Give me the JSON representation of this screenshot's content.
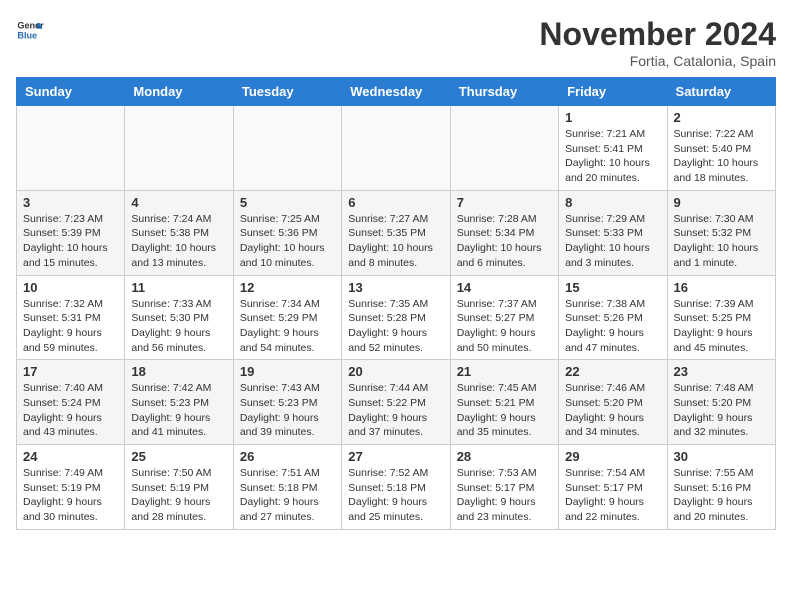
{
  "header": {
    "logo_line1": "General",
    "logo_line2": "Blue",
    "month": "November 2024",
    "location": "Fortia, Catalonia, Spain"
  },
  "weekdays": [
    "Sunday",
    "Monday",
    "Tuesday",
    "Wednesday",
    "Thursday",
    "Friday",
    "Saturday"
  ],
  "weeks": [
    [
      {
        "day": "",
        "info": ""
      },
      {
        "day": "",
        "info": ""
      },
      {
        "day": "",
        "info": ""
      },
      {
        "day": "",
        "info": ""
      },
      {
        "day": "",
        "info": ""
      },
      {
        "day": "1",
        "info": "Sunrise: 7:21 AM\nSunset: 5:41 PM\nDaylight: 10 hours and 20 minutes."
      },
      {
        "day": "2",
        "info": "Sunrise: 7:22 AM\nSunset: 5:40 PM\nDaylight: 10 hours and 18 minutes."
      }
    ],
    [
      {
        "day": "3",
        "info": "Sunrise: 7:23 AM\nSunset: 5:39 PM\nDaylight: 10 hours and 15 minutes."
      },
      {
        "day": "4",
        "info": "Sunrise: 7:24 AM\nSunset: 5:38 PM\nDaylight: 10 hours and 13 minutes."
      },
      {
        "day": "5",
        "info": "Sunrise: 7:25 AM\nSunset: 5:36 PM\nDaylight: 10 hours and 10 minutes."
      },
      {
        "day": "6",
        "info": "Sunrise: 7:27 AM\nSunset: 5:35 PM\nDaylight: 10 hours and 8 minutes."
      },
      {
        "day": "7",
        "info": "Sunrise: 7:28 AM\nSunset: 5:34 PM\nDaylight: 10 hours and 6 minutes."
      },
      {
        "day": "8",
        "info": "Sunrise: 7:29 AM\nSunset: 5:33 PM\nDaylight: 10 hours and 3 minutes."
      },
      {
        "day": "9",
        "info": "Sunrise: 7:30 AM\nSunset: 5:32 PM\nDaylight: 10 hours and 1 minute."
      }
    ],
    [
      {
        "day": "10",
        "info": "Sunrise: 7:32 AM\nSunset: 5:31 PM\nDaylight: 9 hours and 59 minutes."
      },
      {
        "day": "11",
        "info": "Sunrise: 7:33 AM\nSunset: 5:30 PM\nDaylight: 9 hours and 56 minutes."
      },
      {
        "day": "12",
        "info": "Sunrise: 7:34 AM\nSunset: 5:29 PM\nDaylight: 9 hours and 54 minutes."
      },
      {
        "day": "13",
        "info": "Sunrise: 7:35 AM\nSunset: 5:28 PM\nDaylight: 9 hours and 52 minutes."
      },
      {
        "day": "14",
        "info": "Sunrise: 7:37 AM\nSunset: 5:27 PM\nDaylight: 9 hours and 50 minutes."
      },
      {
        "day": "15",
        "info": "Sunrise: 7:38 AM\nSunset: 5:26 PM\nDaylight: 9 hours and 47 minutes."
      },
      {
        "day": "16",
        "info": "Sunrise: 7:39 AM\nSunset: 5:25 PM\nDaylight: 9 hours and 45 minutes."
      }
    ],
    [
      {
        "day": "17",
        "info": "Sunrise: 7:40 AM\nSunset: 5:24 PM\nDaylight: 9 hours and 43 minutes."
      },
      {
        "day": "18",
        "info": "Sunrise: 7:42 AM\nSunset: 5:23 PM\nDaylight: 9 hours and 41 minutes."
      },
      {
        "day": "19",
        "info": "Sunrise: 7:43 AM\nSunset: 5:23 PM\nDaylight: 9 hours and 39 minutes."
      },
      {
        "day": "20",
        "info": "Sunrise: 7:44 AM\nSunset: 5:22 PM\nDaylight: 9 hours and 37 minutes."
      },
      {
        "day": "21",
        "info": "Sunrise: 7:45 AM\nSunset: 5:21 PM\nDaylight: 9 hours and 35 minutes."
      },
      {
        "day": "22",
        "info": "Sunrise: 7:46 AM\nSunset: 5:20 PM\nDaylight: 9 hours and 34 minutes."
      },
      {
        "day": "23",
        "info": "Sunrise: 7:48 AM\nSunset: 5:20 PM\nDaylight: 9 hours and 32 minutes."
      }
    ],
    [
      {
        "day": "24",
        "info": "Sunrise: 7:49 AM\nSunset: 5:19 PM\nDaylight: 9 hours and 30 minutes."
      },
      {
        "day": "25",
        "info": "Sunrise: 7:50 AM\nSunset: 5:19 PM\nDaylight: 9 hours and 28 minutes."
      },
      {
        "day": "26",
        "info": "Sunrise: 7:51 AM\nSunset: 5:18 PM\nDaylight: 9 hours and 27 minutes."
      },
      {
        "day": "27",
        "info": "Sunrise: 7:52 AM\nSunset: 5:18 PM\nDaylight: 9 hours and 25 minutes."
      },
      {
        "day": "28",
        "info": "Sunrise: 7:53 AM\nSunset: 5:17 PM\nDaylight: 9 hours and 23 minutes."
      },
      {
        "day": "29",
        "info": "Sunrise: 7:54 AM\nSunset: 5:17 PM\nDaylight: 9 hours and 22 minutes."
      },
      {
        "day": "30",
        "info": "Sunrise: 7:55 AM\nSunset: 5:16 PM\nDaylight: 9 hours and 20 minutes."
      }
    ]
  ]
}
